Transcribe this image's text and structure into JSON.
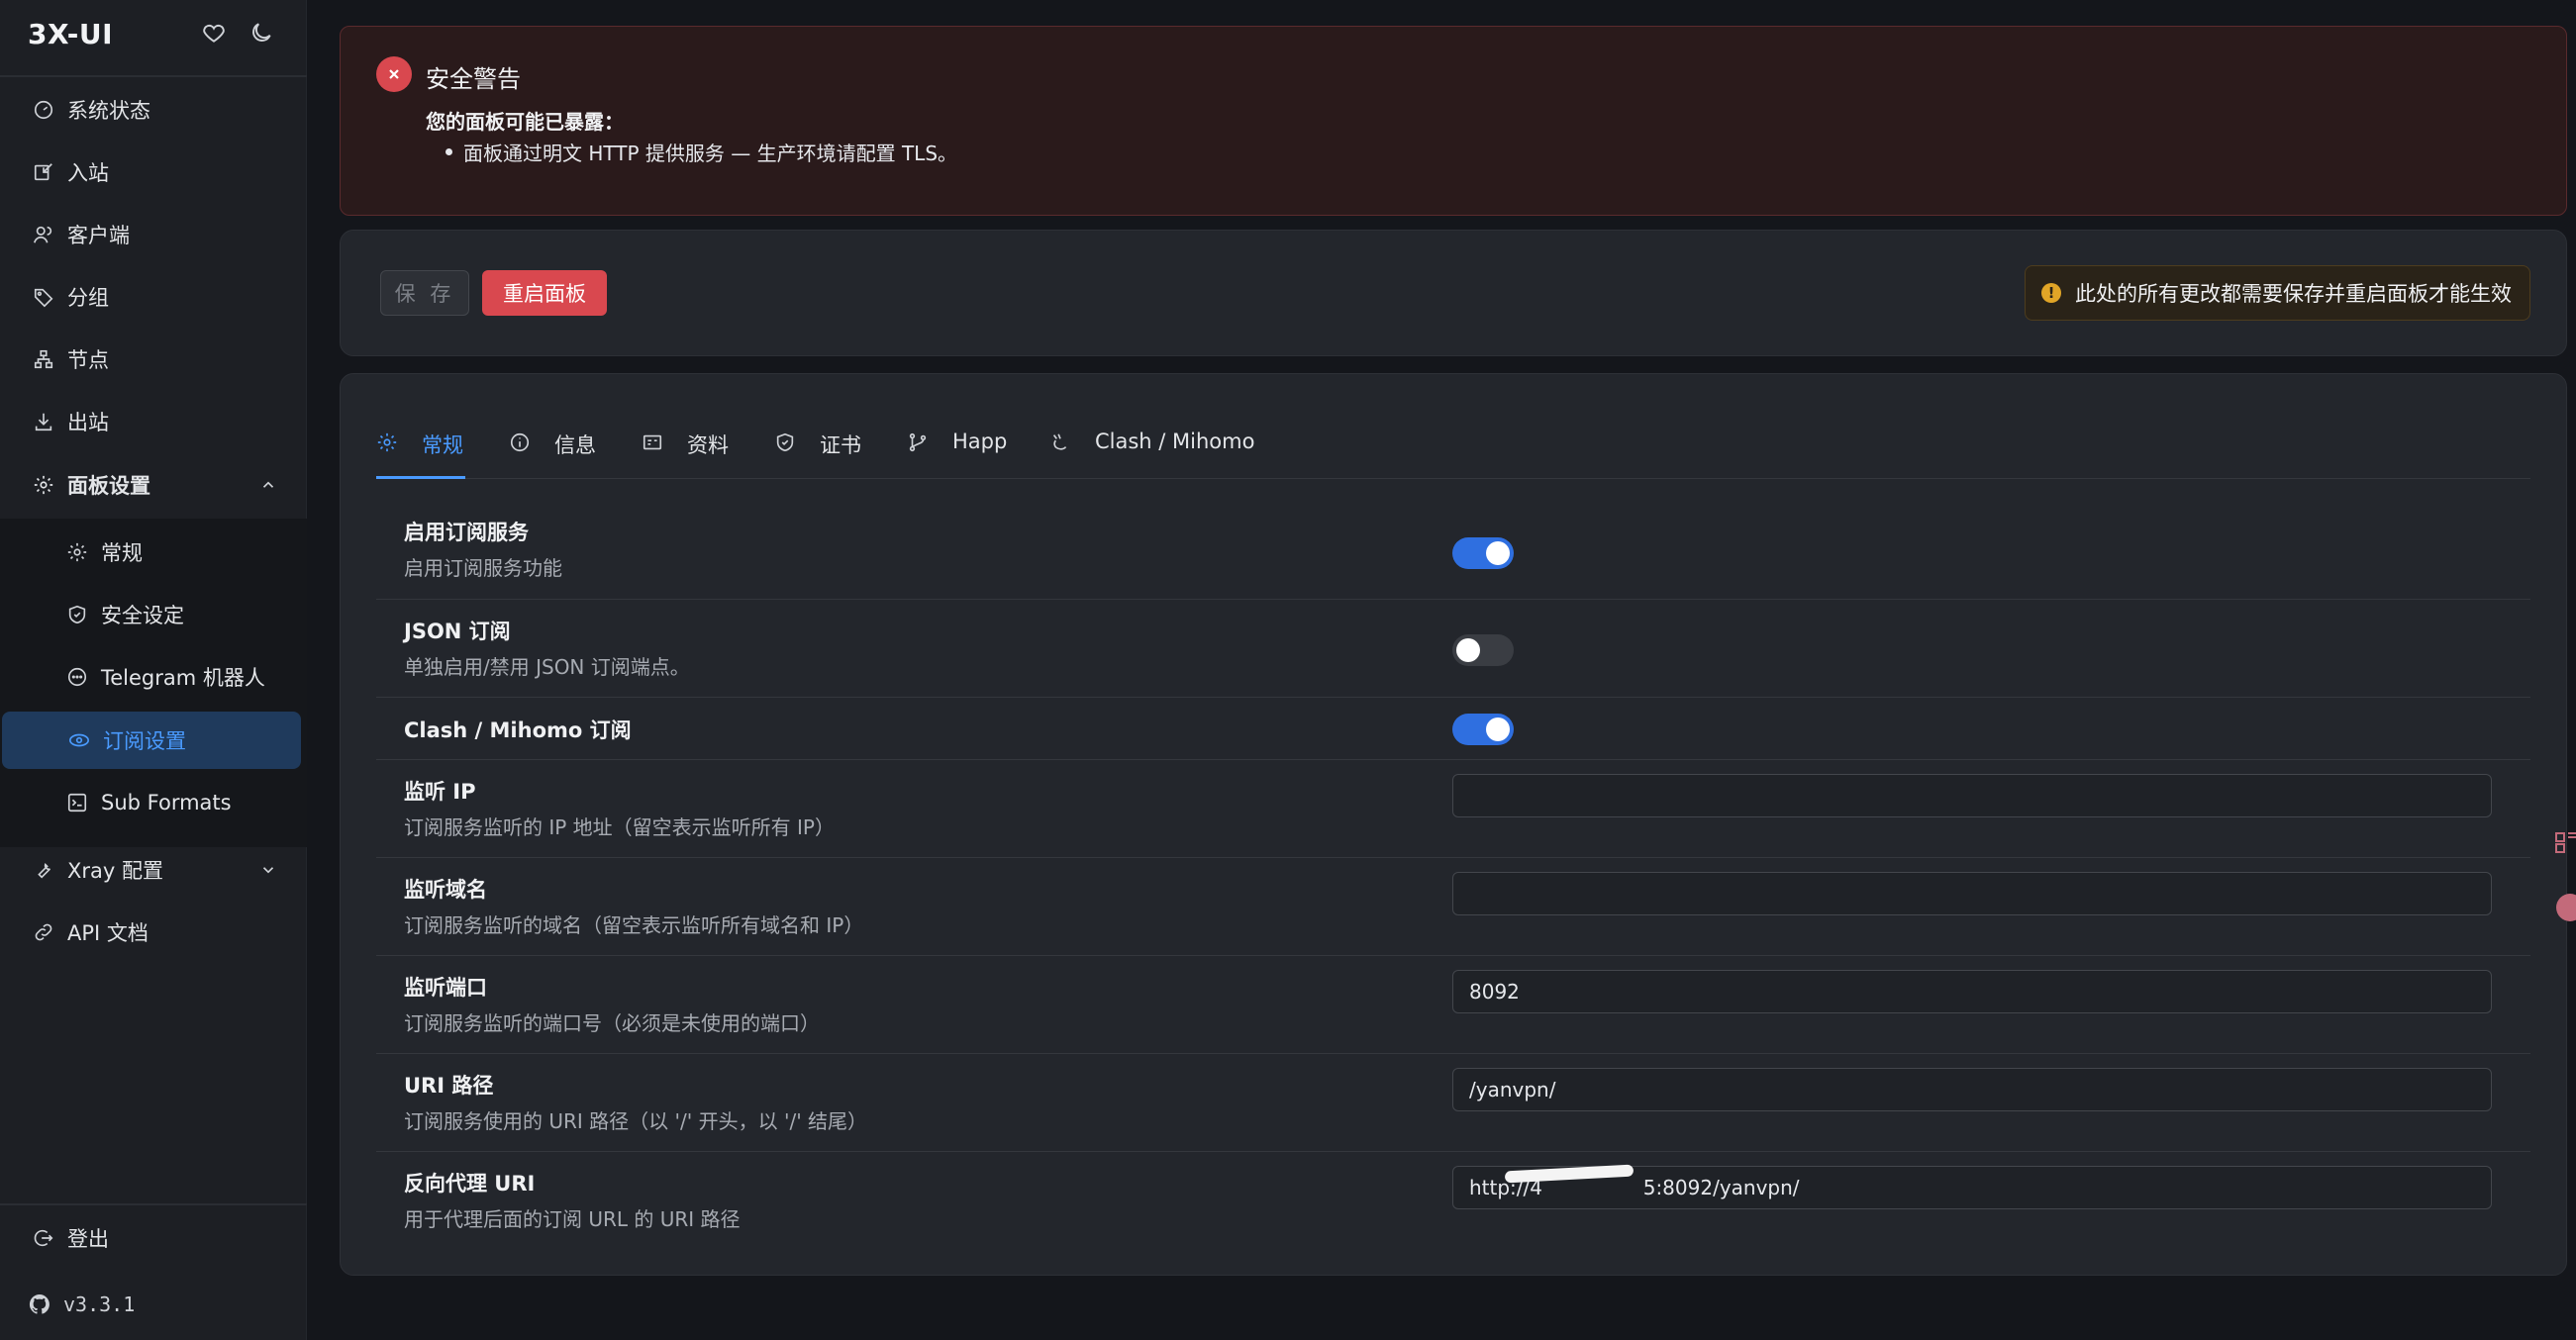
{
  "sidebar": {
    "brand": "3X-UI",
    "items": [
      {
        "label": "系统状态",
        "icon": "dashboard-icon"
      },
      {
        "label": "入站",
        "icon": "inbound-icon"
      },
      {
        "label": "客户端",
        "icon": "users-icon"
      },
      {
        "label": "分组",
        "icon": "tag-icon"
      },
      {
        "label": "节点",
        "icon": "nodes-icon"
      },
      {
        "label": "出站",
        "icon": "outbound-icon"
      },
      {
        "label": "面板设置",
        "icon": "gear-icon",
        "expanded": true
      }
    ],
    "sub_items": [
      {
        "label": "常规",
        "icon": "gear-icon"
      },
      {
        "label": "安全设定",
        "icon": "shield-icon"
      },
      {
        "label": "Telegram 机器人",
        "icon": "chat-icon"
      },
      {
        "label": "订阅设置",
        "icon": "cloud-icon",
        "active": true
      },
      {
        "label": "Sub Formats",
        "icon": "code-icon"
      }
    ],
    "more_items": [
      {
        "label": "Xray 配置",
        "icon": "wrench-icon"
      },
      {
        "label": "API 文档",
        "icon": "link-icon"
      }
    ],
    "logout": "登出",
    "version": "v3.3.1"
  },
  "alert": {
    "title": "安全警告",
    "subtitle": "您的面板可能已暴露：",
    "items": [
      "面板通过明文 HTTP 提供服务 — 生产环境请配置 TLS。"
    ]
  },
  "actions": {
    "save_label": "保 存",
    "restart_label": "重启面板",
    "notice": "此处的所有更改都需要保存并重启面板才能生效"
  },
  "tabs": [
    {
      "label": "常规",
      "icon": "gear-icon",
      "active": true
    },
    {
      "label": "信息",
      "icon": "info-icon"
    },
    {
      "label": "资料",
      "icon": "profile-icon"
    },
    {
      "label": "证书",
      "icon": "shield-icon"
    },
    {
      "label": "Happ",
      "icon": "branch-icon"
    },
    {
      "label": "Clash / Mihomo",
      "icon": "cat-icon"
    }
  ],
  "settings": [
    {
      "title": "启用订阅服务",
      "desc": "启用订阅服务功能",
      "type": "toggle",
      "value": true
    },
    {
      "title": "JSON 订阅",
      "desc": "单独启用/禁用 JSON 订阅端点。",
      "type": "toggle",
      "value": false
    },
    {
      "title": "Clash / Mihomo 订阅",
      "desc": "",
      "type": "toggle",
      "value": true
    },
    {
      "title": "监听 IP",
      "desc": "订阅服务监听的 IP 地址（留空表示监听所有 IP）",
      "type": "input",
      "value": ""
    },
    {
      "title": "监听域名",
      "desc": "订阅服务监听的域名（留空表示监听所有域名和 IP）",
      "type": "input",
      "value": ""
    },
    {
      "title": "监听端口",
      "desc": "订阅服务监听的端口号（必须是未使用的端口）",
      "type": "input",
      "value": "8092"
    },
    {
      "title": "URI 路径",
      "desc": "订阅服务使用的 URI 路径（以 '/' 开头，以 '/' 结尾）",
      "type": "input",
      "value": "/yanvpn/"
    },
    {
      "title": "反向代理 URI",
      "desc": "用于代理后面的订阅 URL 的 URI 路径",
      "type": "input",
      "value": "http://4                5:8092/yanvpn/"
    }
  ],
  "colors": {
    "accent": "#4a9bff",
    "danger": "#d9484f",
    "warning": "#e1a527",
    "toggle_on": "#2f6fe0"
  }
}
